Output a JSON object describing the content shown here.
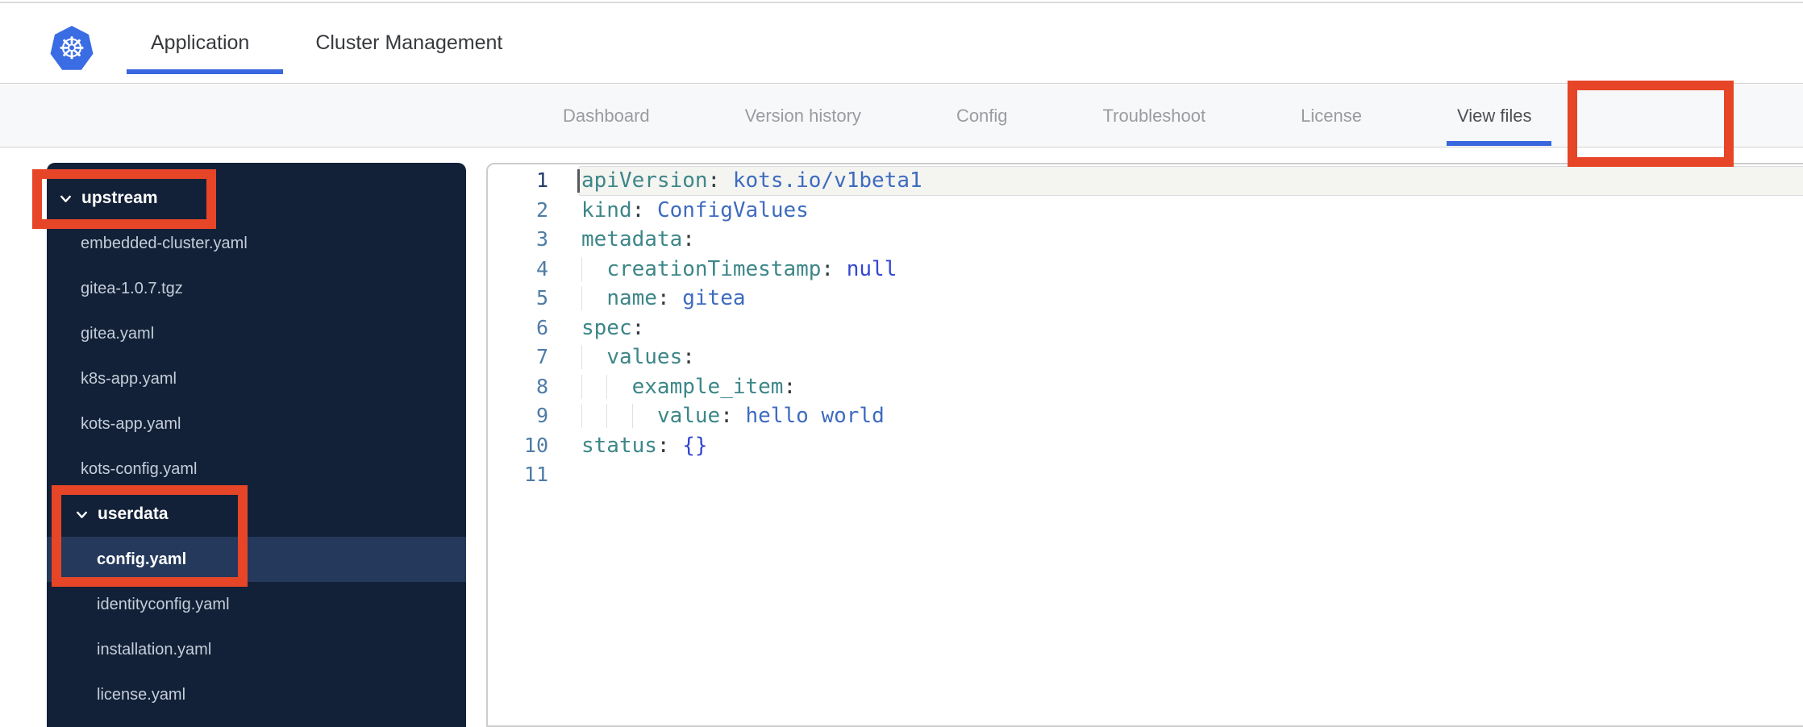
{
  "header": {
    "logo": "kubernetes-logo",
    "logo_glyph": "☸",
    "tabs": [
      {
        "label": "Application",
        "active": true
      },
      {
        "label": "Cluster Management",
        "active": false
      }
    ]
  },
  "nav": {
    "tabs": [
      {
        "label": "Dashboard",
        "active": false
      },
      {
        "label": "Version history",
        "active": false
      },
      {
        "label": "Config",
        "active": false
      },
      {
        "label": "Troubleshoot",
        "active": false
      },
      {
        "label": "License",
        "active": false
      },
      {
        "label": "View files",
        "active": true
      }
    ]
  },
  "file_tree": {
    "items": [
      {
        "label": "upstream",
        "kind": "folder",
        "depth": 0,
        "expanded": true,
        "selected": false
      },
      {
        "label": "embedded-cluster.yaml",
        "kind": "file",
        "depth": 1,
        "selected": false
      },
      {
        "label": "gitea-1.0.7.tgz",
        "kind": "file",
        "depth": 1,
        "selected": false
      },
      {
        "label": "gitea.yaml",
        "kind": "file",
        "depth": 1,
        "selected": false
      },
      {
        "label": "k8s-app.yaml",
        "kind": "file",
        "depth": 1,
        "selected": false
      },
      {
        "label": "kots-app.yaml",
        "kind": "file",
        "depth": 1,
        "selected": false
      },
      {
        "label": "kots-config.yaml",
        "kind": "file",
        "depth": 1,
        "selected": false
      },
      {
        "label": "userdata",
        "kind": "folder",
        "depth": 1,
        "expanded": true,
        "selected": false
      },
      {
        "label": "config.yaml",
        "kind": "file",
        "depth": 2,
        "selected": true
      },
      {
        "label": "identityconfig.yaml",
        "kind": "file",
        "depth": 2,
        "selected": false
      },
      {
        "label": "installation.yaml",
        "kind": "file",
        "depth": 2,
        "selected": false
      },
      {
        "label": "license.yaml",
        "kind": "file",
        "depth": 2,
        "selected": false
      }
    ]
  },
  "editor": {
    "language": "yaml",
    "lines": [
      {
        "n": 1,
        "indent": 0,
        "active": true,
        "tokens": [
          {
            "t": "key",
            "s": "apiVersion"
          },
          {
            "t": "punc",
            "s": ": "
          },
          {
            "t": "val",
            "s": "kots.io/v1beta1"
          }
        ]
      },
      {
        "n": 2,
        "indent": 0,
        "active": false,
        "tokens": [
          {
            "t": "key",
            "s": "kind"
          },
          {
            "t": "punc",
            "s": ": "
          },
          {
            "t": "val",
            "s": "ConfigValues"
          }
        ]
      },
      {
        "n": 3,
        "indent": 0,
        "active": false,
        "tokens": [
          {
            "t": "key",
            "s": "metadata"
          },
          {
            "t": "punc",
            "s": ":"
          }
        ]
      },
      {
        "n": 4,
        "indent": 1,
        "active": false,
        "tokens": [
          {
            "t": "key",
            "s": "creationTimestamp"
          },
          {
            "t": "punc",
            "s": ": "
          },
          {
            "t": "lit",
            "s": "null"
          }
        ]
      },
      {
        "n": 5,
        "indent": 1,
        "active": false,
        "tokens": [
          {
            "t": "key",
            "s": "name"
          },
          {
            "t": "punc",
            "s": ": "
          },
          {
            "t": "val",
            "s": "gitea"
          }
        ]
      },
      {
        "n": 6,
        "indent": 0,
        "active": false,
        "tokens": [
          {
            "t": "key",
            "s": "spec"
          },
          {
            "t": "punc",
            "s": ":"
          }
        ]
      },
      {
        "n": 7,
        "indent": 1,
        "active": false,
        "tokens": [
          {
            "t": "key",
            "s": "values"
          },
          {
            "t": "punc",
            "s": ":"
          }
        ]
      },
      {
        "n": 8,
        "indent": 2,
        "active": false,
        "tokens": [
          {
            "t": "key",
            "s": "example_item"
          },
          {
            "t": "punc",
            "s": ":"
          }
        ]
      },
      {
        "n": 9,
        "indent": 3,
        "active": false,
        "tokens": [
          {
            "t": "key",
            "s": "value"
          },
          {
            "t": "punc",
            "s": ": "
          },
          {
            "t": "val",
            "s": "hello world"
          }
        ]
      },
      {
        "n": 10,
        "indent": 0,
        "active": false,
        "tokens": [
          {
            "t": "key",
            "s": "status"
          },
          {
            "t": "punc",
            "s": ": "
          },
          {
            "t": "lit",
            "s": "{}"
          }
        ]
      },
      {
        "n": 11,
        "indent": 0,
        "active": false,
        "tokens": []
      }
    ]
  },
  "annotations": {
    "color": "#e64527",
    "boxes": [
      "upstream-folder",
      "userdata-config-selection",
      "view-files-tab"
    ]
  },
  "colors": {
    "accent_blue": "#3867de",
    "kubernetes_blue": "#3a6de4",
    "sidebar_bg": "#132138",
    "sidebar_selected_bg": "#24395b",
    "annotation_red": "#e64527",
    "yaml_key": "#3d8688",
    "yaml_value": "#3e6bbf",
    "yaml_literal": "#3347d1"
  }
}
